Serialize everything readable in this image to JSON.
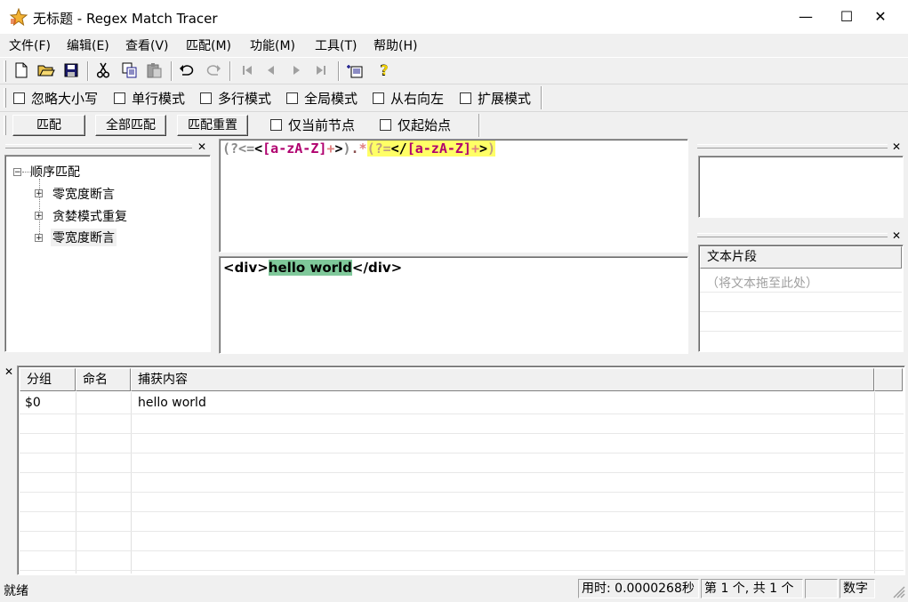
{
  "window": {
    "title": "无标题 - Regex Match Tracer",
    "minimize": "—",
    "maximize": "☐",
    "close": "✕"
  },
  "menu": [
    {
      "label": "文件(F)"
    },
    {
      "label": "编辑(E)"
    },
    {
      "label": "查看(V)"
    },
    {
      "label": "匹配(M)"
    },
    {
      "label": "功能(M)"
    },
    {
      "label": "工具(T)"
    },
    {
      "label": "帮助(H)"
    }
  ],
  "toolbar_icons": [
    "new-file-icon",
    "open-folder-icon",
    "save-icon",
    "cut-icon",
    "copy-icon",
    "paste-icon",
    "undo-icon",
    "redo-icon",
    "first-icon",
    "prev-icon",
    "next-icon",
    "last-icon",
    "insert-icon",
    "help-icon"
  ],
  "options": [
    {
      "label": "忽略大小写"
    },
    {
      "label": "单行模式"
    },
    {
      "label": "多行模式"
    },
    {
      "label": "全局模式"
    },
    {
      "label": "从右向左"
    },
    {
      "label": "扩展模式"
    }
  ],
  "actions": {
    "match": "匹配",
    "match_all": "全部匹配",
    "match_reset": "匹配重置",
    "current_node": "仅当前节点",
    "start_only": "仅起始点"
  },
  "tree": {
    "root": "顺序匹配",
    "root_toggle": "−",
    "child_toggle": "+",
    "children": [
      "零宽度断言",
      "贪婪模式重复",
      "零宽度断言"
    ]
  },
  "regex_tokens": {
    "t1": "(?<=",
    "t2": "<",
    "t3": "[a-zA-Z]",
    "t4": "+",
    "t5": ">",
    "t6": ")",
    "t7": ".",
    "t8": "*",
    "t9": "(?=",
    "t10": "</",
    "t11": "[a-zA-Z]",
    "t12": "+",
    "t13": ">",
    "t14": ")"
  },
  "subject": {
    "before": "<div>",
    "match": "hello world",
    "after": "</div>"
  },
  "snippets": {
    "header": "文本片段",
    "placeholder": "（将文本拖至此处）"
  },
  "grid": {
    "columns": [
      "分组",
      "命名",
      "捕获内容"
    ],
    "rows": [
      {
        "group": "$0",
        "name": "",
        "capture": "hello world"
      }
    ]
  },
  "status": {
    "ready": "就绪",
    "time": "用时: 0.0000268秒",
    "count": "第 1 个, 共 1 个",
    "num": "数字"
  },
  "colors": {
    "match_highlight": "#7fc89a",
    "lookahead_highlight": "#ffff66",
    "charset": "#b0006f"
  }
}
